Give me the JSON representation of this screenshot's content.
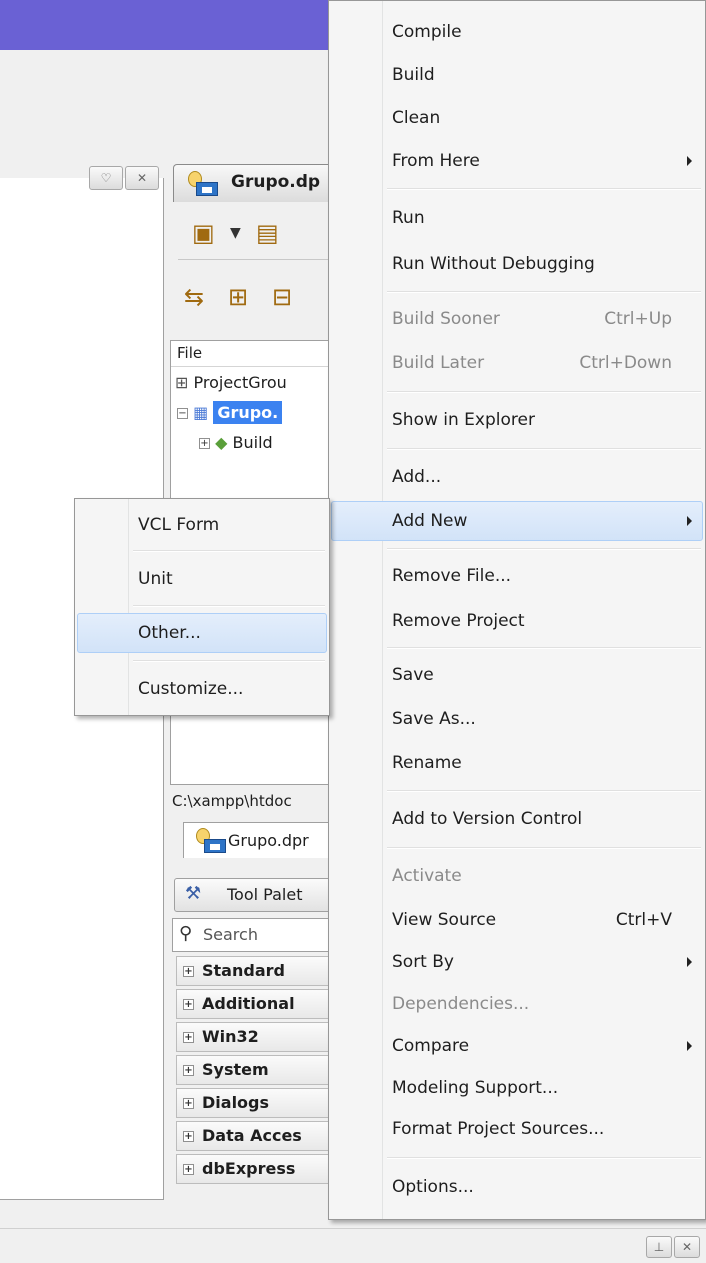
{
  "project_manager": {
    "tab_label": "Grupo.dp",
    "file_header": "File",
    "tree": [
      {
        "label": "ProjectGrou"
      },
      {
        "label": "Grupo."
      },
      {
        "label": "Build"
      }
    ],
    "path": "C:\\xampp\\htdoc",
    "file_tab": "Grupo.dpr"
  },
  "tool_palette": {
    "tab_label": "Tool Palet",
    "search_placeholder": "Search",
    "categories": [
      "Standard",
      "Additional",
      "Win32",
      "System",
      "Dialogs",
      "Data Acces",
      "dbExpress"
    ]
  },
  "context_menu": {
    "items": [
      {
        "label": "Compile"
      },
      {
        "label": "Build"
      },
      {
        "label": "Clean"
      },
      {
        "label": "From Here",
        "submenu": true
      },
      {
        "label": "Run"
      },
      {
        "label": "Run Without Debugging"
      },
      {
        "label": "Build Sooner",
        "shortcut": "Ctrl+Up",
        "disabled": true
      },
      {
        "label": "Build Later",
        "shortcut": "Ctrl+Down",
        "disabled": true
      },
      {
        "label": "Show in Explorer"
      },
      {
        "label": "Add..."
      },
      {
        "label": "Add New",
        "submenu": true,
        "highlighted": true
      },
      {
        "label": "Remove File..."
      },
      {
        "label": "Remove Project"
      },
      {
        "label": "Save"
      },
      {
        "label": "Save As..."
      },
      {
        "label": "Rename"
      },
      {
        "label": "Add to Version Control"
      },
      {
        "label": "Activate",
        "disabled": true
      },
      {
        "label": "View Source",
        "shortcut": "Ctrl+V"
      },
      {
        "label": "Sort By",
        "submenu": true
      },
      {
        "label": "Dependencies...",
        "disabled": true
      },
      {
        "label": "Compare",
        "submenu": true
      },
      {
        "label": "Modeling Support..."
      },
      {
        "label": "Format Project Sources..."
      },
      {
        "label": "Options..."
      }
    ]
  },
  "add_new_submenu": {
    "items": [
      {
        "label": "VCL Form"
      },
      {
        "label": "Unit"
      },
      {
        "label": "Other...",
        "highlighted": true
      },
      {
        "label": "Customize..."
      }
    ]
  },
  "colors": {
    "title_bar": "#6a61d4",
    "menu_bg": "#f5f5f5",
    "highlight": "#d2e3f8",
    "selection": "#3b82f0"
  }
}
